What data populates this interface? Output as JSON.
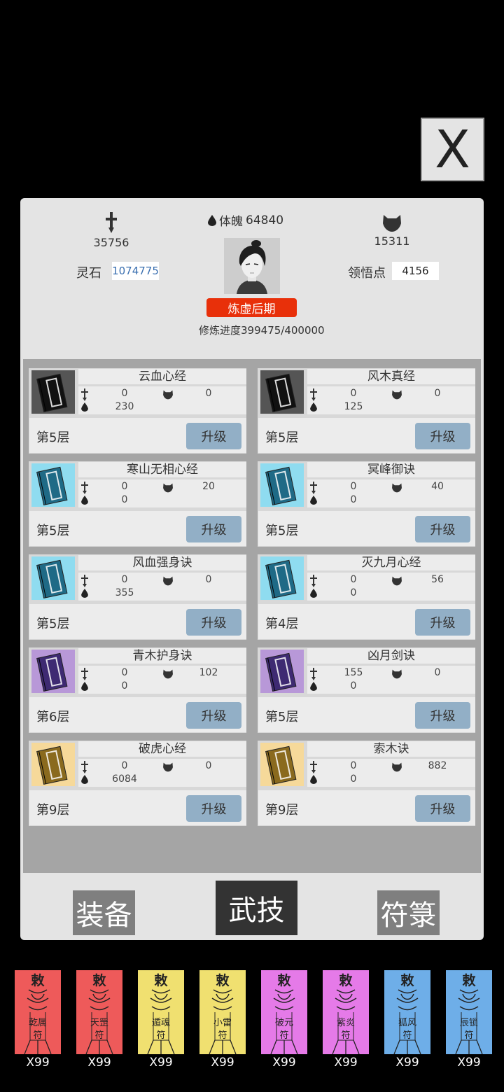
{
  "close_label": "X",
  "stats": {
    "attack": "35756",
    "defense": "15311",
    "tipo_label": "体魄",
    "tipo_value": "64840"
  },
  "resources": {
    "lingshi_label": "灵石",
    "lingshi_value": "1074775",
    "lingwu_label": "领悟点",
    "lingwu_value": "4156"
  },
  "realm": "炼虚后期",
  "progress": {
    "label": "修炼进度",
    "value": "399475/400000"
  },
  "upgrade_label": "升级",
  "skills": [
    {
      "name": "云血心经",
      "atk": "0",
      "def": "0",
      "hp": "230",
      "level": "第5层",
      "color": "#555555",
      "book": "#111111"
    },
    {
      "name": "风木真经",
      "atk": "0",
      "def": "0",
      "hp": "125",
      "level": "第5层",
      "color": "#555555",
      "book": "#111111"
    },
    {
      "name": "寒山无相心经",
      "atk": "0",
      "def": "20",
      "hp": "0",
      "level": "第5层",
      "color": "#8fdcf0",
      "book": "#1f6a86"
    },
    {
      "name": "冥峰御诀",
      "atk": "0",
      "def": "40",
      "hp": "0",
      "level": "第5层",
      "color": "#8fdcf0",
      "book": "#1f6a86"
    },
    {
      "name": "风血强身诀",
      "atk": "0",
      "def": "0",
      "hp": "355",
      "level": "第5层",
      "color": "#8fdcf0",
      "book": "#1f6a86"
    },
    {
      "name": "灭九月心经",
      "atk": "0",
      "def": "56",
      "hp": "0",
      "level": "第4层",
      "color": "#8fdcf0",
      "book": "#1f6a86"
    },
    {
      "name": "青木护身诀",
      "atk": "0",
      "def": "102",
      "hp": "0",
      "level": "第6层",
      "color": "#b898d8",
      "book": "#3e2a72"
    },
    {
      "name": "凶月剑诀",
      "atk": "155",
      "def": "0",
      "hp": "0",
      "level": "第5层",
      "color": "#b898d8",
      "book": "#3e2a72"
    },
    {
      "name": "破虎心经",
      "atk": "0",
      "def": "0",
      "hp": "6084",
      "level": "第9层",
      "color": "#f6d99a",
      "book": "#8a6a1e"
    },
    {
      "name": "索木诀",
      "atk": "0",
      "def": "882",
      "hp": "0",
      "level": "第9层",
      "color": "#f6d99a",
      "book": "#8a6a1e"
    }
  ],
  "tabs": {
    "equip": "装备",
    "martial": "武技",
    "talisman": "符箓"
  },
  "talismans": [
    {
      "line1": "乾属",
      "line2": "符",
      "count": "X99",
      "color": "#ee5a5a"
    },
    {
      "line1": "天罡",
      "line2": "符",
      "count": "X99",
      "color": "#ee5a5a"
    },
    {
      "line1": "遁魂",
      "line2": "符",
      "count": "X99",
      "color": "#f0e070"
    },
    {
      "line1": "小雷",
      "line2": "符",
      "count": "X99",
      "color": "#f0e070"
    },
    {
      "line1": "破元",
      "line2": "符",
      "count": "X99",
      "color": "#e57ae8"
    },
    {
      "line1": "紫炎",
      "line2": "符",
      "count": "X99",
      "color": "#e57ae8"
    },
    {
      "line1": "狐风",
      "line2": "符",
      "count": "X99",
      "color": "#6eaee8"
    },
    {
      "line1": "辰锁",
      "line2": "符",
      "count": "X99",
      "color": "#6eaee8"
    }
  ],
  "talisman_header": "敕"
}
